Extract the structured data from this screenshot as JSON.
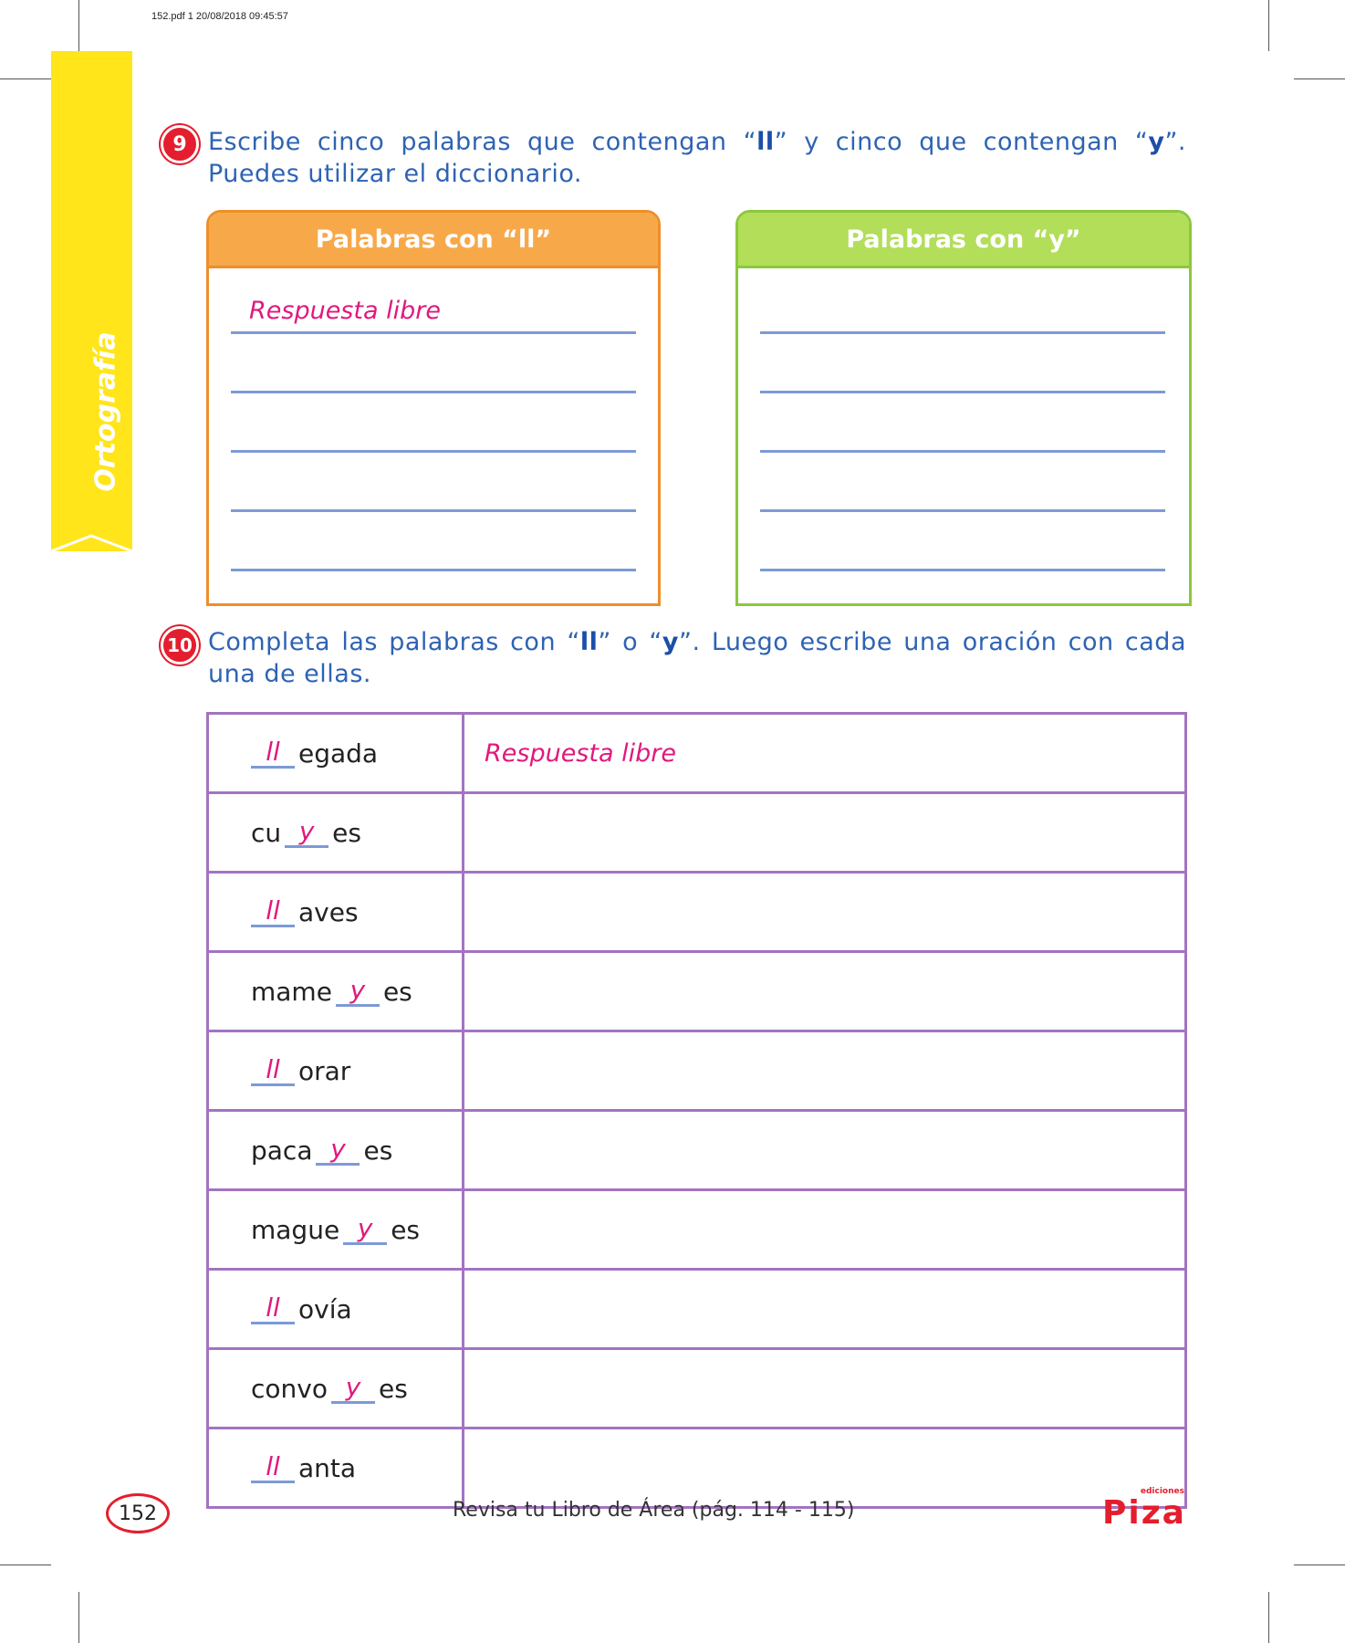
{
  "header": {
    "file_info": "152.pdf   1   20/08/2018   09:45:57"
  },
  "side_tab": {
    "label": "Ortografía"
  },
  "q9": {
    "number": "9",
    "text_before_ll": "Escribe cinco palabras que contengan “",
    "ll": "ll",
    "text_middle": "” y cinco que contengan “",
    "y": "y",
    "text_end": "”. Puedes utilizar el diccionario.",
    "box_ll": {
      "title": "Palabras con “ll”",
      "answer": "Respuesta libre"
    },
    "box_y": {
      "title": "Palabras con “y”"
    }
  },
  "q10": {
    "number": "10",
    "text_before_ll": "Completa las palabras con “",
    "ll": "ll",
    "text_middle": "” o “",
    "y": "y",
    "text_end": "”. Luego escribe una oración con cada una de ellas.",
    "answer": "Respuesta libre",
    "rows": [
      {
        "pre": "",
        "fill": "ll",
        "post": "egada"
      },
      {
        "pre": "cu",
        "fill": "y",
        "post": "es"
      },
      {
        "pre": "",
        "fill": "ll",
        "post": "aves"
      },
      {
        "pre": "mame",
        "fill": "y",
        "post": "es"
      },
      {
        "pre": "",
        "fill": "ll",
        "post": "orar"
      },
      {
        "pre": "paca",
        "fill": "y",
        "post": "es"
      },
      {
        "pre": "mague",
        "fill": "y",
        "post": "es"
      },
      {
        "pre": "",
        "fill": "ll",
        "post": "ovía"
      },
      {
        "pre": "convo",
        "fill": "y",
        "post": "es"
      },
      {
        "pre": "",
        "fill": "ll",
        "post": "anta"
      }
    ]
  },
  "footer": {
    "page_number": "152",
    "reference": "Revisa tu Libro de Área (pág. 114 - 115)",
    "logo_sub": "ediciones",
    "logo": "Piza"
  },
  "colors": {
    "orange": "#f7a94a",
    "orange_border": "#ef8e2a",
    "green": "#b2de5a",
    "green_border": "#8cc83c",
    "purple": "#a373c1",
    "blue_text": "#2e63b3",
    "pink": "#e0197d",
    "yellow": "#ffe51a",
    "red": "#e41e2e"
  }
}
